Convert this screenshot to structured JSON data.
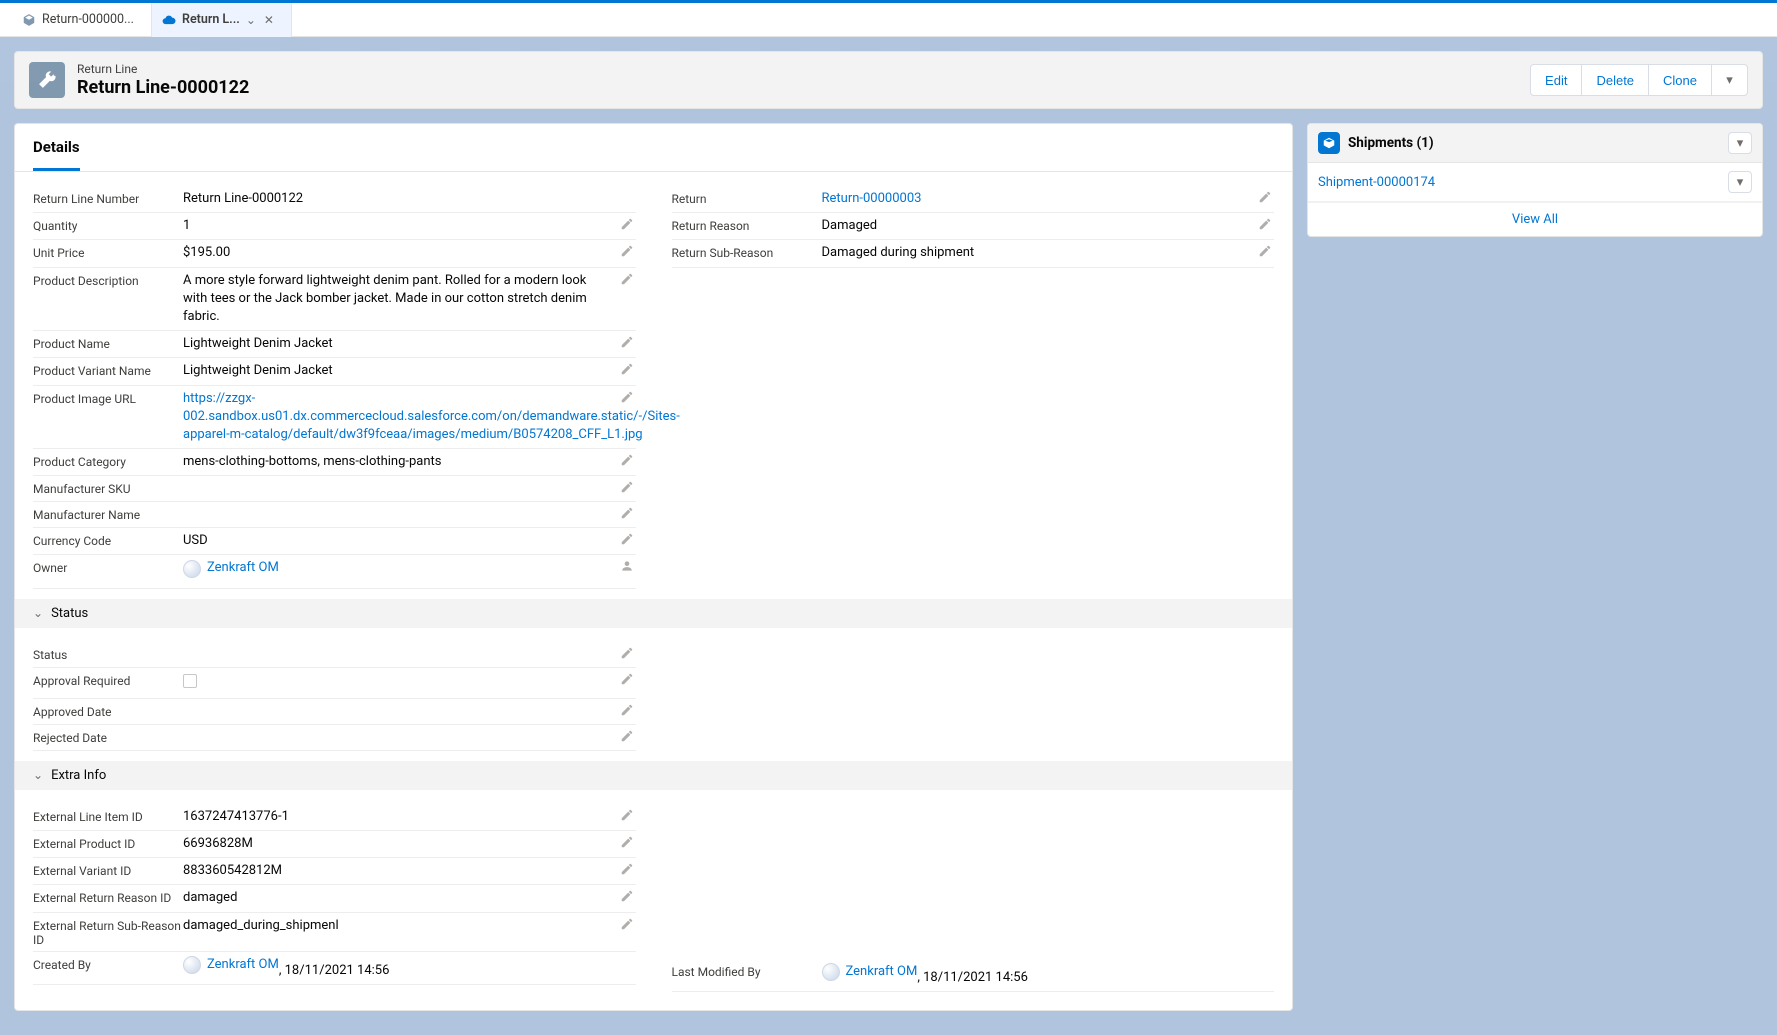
{
  "tabs": [
    {
      "label": "Return-000000...",
      "active": false
    },
    {
      "label": "Return L...",
      "active": true
    }
  ],
  "record": {
    "entity_label": "Return Line",
    "title": "Return Line-0000122"
  },
  "header_actions": {
    "edit": "Edit",
    "delete": "Delete",
    "clone": "Clone"
  },
  "details_tab": "Details",
  "left_fields": {
    "return_line_number": {
      "label": "Return Line Number",
      "value": "Return Line-0000122",
      "editable": false
    },
    "quantity": {
      "label": "Quantity",
      "value": "1",
      "editable": true
    },
    "unit_price": {
      "label": "Unit Price",
      "value": "$195.00",
      "editable": true
    },
    "product_description": {
      "label": "Product Description",
      "value": "A more style forward lightweight denim pant. Rolled for a modern look with tees or the Jack bomber jacket. Made in our cotton stretch denim fabric.",
      "editable": true
    },
    "product_name": {
      "label": "Product Name",
      "value": "Lightweight Denim Jacket",
      "editable": true
    },
    "product_variant_name": {
      "label": "Product Variant Name",
      "value": "Lightweight Denim Jacket",
      "editable": true
    },
    "product_image_url": {
      "label": "Product Image URL",
      "value": "https://zzgx-002.sandbox.us01.dx.commercecloud.salesforce.com/on/demandware.static/-/Sites-apparel-m-catalog/default/dw3f9fceaa/images/medium/B0574208_CFF_L1.jpg",
      "editable": true,
      "link": true
    },
    "product_category": {
      "label": "Product Category",
      "value": "mens-clothing-bottoms, mens-clothing-pants",
      "editable": true
    },
    "manufacturer_sku": {
      "label": "Manufacturer SKU",
      "value": "",
      "editable": true
    },
    "manufacturer_name": {
      "label": "Manufacturer Name",
      "value": "",
      "editable": true
    },
    "currency_code": {
      "label": "Currency Code",
      "value": "USD",
      "editable": true
    },
    "owner": {
      "label": "Owner",
      "value": "Zenkraft OM",
      "editable": true,
      "owner": true
    }
  },
  "right_fields": {
    "return": {
      "label": "Return",
      "value": "Return-00000003",
      "editable": true,
      "link": true
    },
    "return_reason": {
      "label": "Return Reason",
      "value": "Damaged",
      "editable": true
    },
    "return_sub_reason": {
      "label": "Return Sub-Reason",
      "value": "Damaged during shipment",
      "editable": true
    }
  },
  "status_section": {
    "title": "Status",
    "fields": {
      "status": {
        "label": "Status",
        "value": "",
        "editable": true
      },
      "approval_required": {
        "label": "Approval Required",
        "value": "",
        "checkbox": true,
        "editable": true
      },
      "approved_date": {
        "label": "Approved Date",
        "value": "",
        "editable": true
      },
      "rejected_date": {
        "label": "Rejected Date",
        "value": "",
        "editable": true
      }
    }
  },
  "extra_info_section": {
    "title": "Extra Info",
    "left": {
      "external_line_item_id": {
        "label": "External Line Item ID",
        "value": "1637247413776-1",
        "editable": true
      },
      "external_product_id": {
        "label": "External Product ID",
        "value": "66936828M",
        "editable": true
      },
      "external_variant_id": {
        "label": "External Variant ID",
        "value": "883360542812M",
        "editable": true
      },
      "external_return_reason_id": {
        "label": "External Return Reason ID",
        "value": "damaged",
        "editable": true
      },
      "external_return_sub_reason_id": {
        "label": "External Return Sub-Reason ID",
        "value": "damaged_during_shipmenl",
        "editable": true
      },
      "created_by": {
        "label": "Created By",
        "owner": "Zenkraft OM",
        "date": ", 18/11/2021 14:56"
      }
    },
    "right": {
      "last_modified_by": {
        "label": "Last Modified By",
        "owner": "Zenkraft OM",
        "date": ", 18/11/2021 14:56"
      }
    }
  },
  "related": {
    "shipments": {
      "title": "Shipments (1)",
      "items": [
        {
          "name": "Shipment-00000174"
        }
      ],
      "view_all": "View All"
    }
  }
}
